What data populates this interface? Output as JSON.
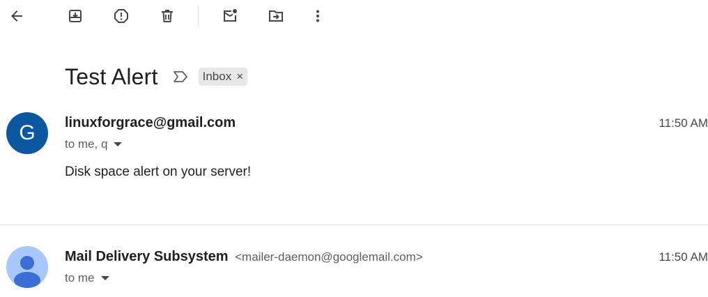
{
  "toolbar": {
    "icons": [
      "back-arrow-icon",
      "archive-icon",
      "report-spam-icon",
      "delete-icon",
      "mark-unread-icon",
      "move-to-icon",
      "more-vert-icon"
    ]
  },
  "thread": {
    "subject": "Test Alert",
    "label": "Inbox",
    "label_close": "×"
  },
  "messages": [
    {
      "avatar_letter": "G",
      "avatar_color": "#0b57a0",
      "sender_name": "linuxforgrace@gmail.com",
      "sender_email": "",
      "time": "11:50 AM",
      "recipients": "to me, q",
      "body": "Disk space alert on your server!"
    },
    {
      "avatar_icon": "person-icon",
      "avatar_color": "#a8c7fa",
      "sender_name": "Mail Delivery Subsystem",
      "sender_email": "<mailer-daemon@googlemail.com>",
      "time": "11:50 AM",
      "recipients": "to me"
    }
  ]
}
